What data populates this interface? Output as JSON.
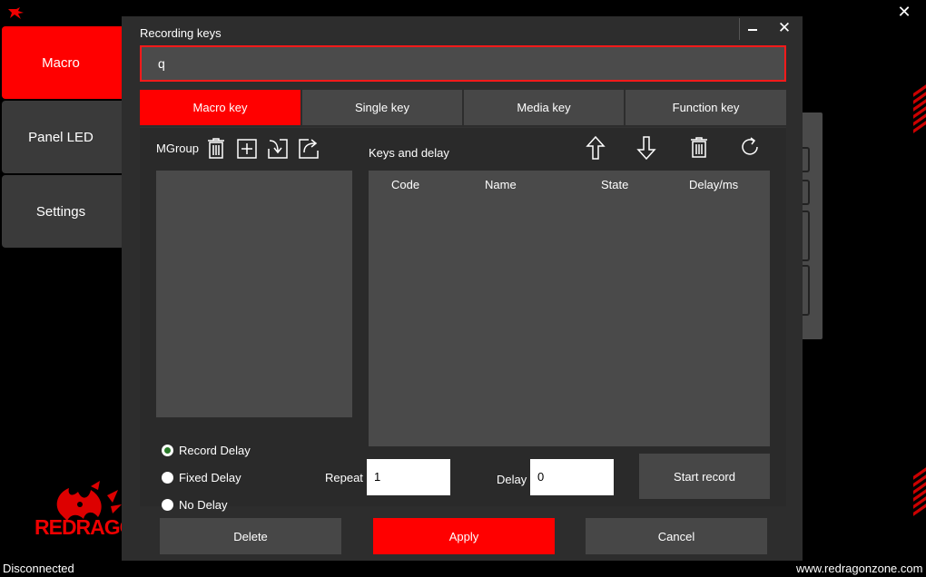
{
  "app": {
    "close_glyph": "✕",
    "nav": [
      {
        "label": "Macro",
        "active": true
      },
      {
        "label": "Panel LED",
        "active": false
      },
      {
        "label": "Settings",
        "active": false
      }
    ],
    "brand_text": "REDRAGON",
    "status": "Disconnected",
    "website": "www.redragonzone.com",
    "accent_color": "#ff0000"
  },
  "dialog": {
    "title": "Recording keys",
    "minimize_glyph": "▬",
    "close_glyph": "✕",
    "recording_value": "q",
    "tabs": [
      {
        "label": "Macro key",
        "active": true
      },
      {
        "label": "Single key",
        "active": false
      },
      {
        "label": "Media key",
        "active": false
      },
      {
        "label": "Function key",
        "active": false
      }
    ],
    "mgroup": {
      "label": "MGroup",
      "icons": [
        "trash-icon",
        "add-icon",
        "import-icon",
        "export-icon"
      ]
    },
    "delay_modes": [
      {
        "label": "Record Delay",
        "checked": true
      },
      {
        "label": "Fixed Delay",
        "checked": false
      },
      {
        "label": "No Delay",
        "checked": false
      }
    ],
    "keys": {
      "label": "Keys and delay",
      "icons": [
        "arrow-up-icon",
        "arrow-down-icon",
        "trash-icon",
        "refresh-icon"
      ],
      "columns": [
        "Code",
        "Name",
        "State",
        "Delay/ms"
      ]
    },
    "repeat": {
      "label": "Repeat",
      "value": "1"
    },
    "delay": {
      "label": "Delay",
      "value": "0"
    },
    "start_record_label": "Start record",
    "footer": {
      "delete_label": "Delete",
      "apply_label": "Apply",
      "cancel_label": "Cancel"
    }
  }
}
